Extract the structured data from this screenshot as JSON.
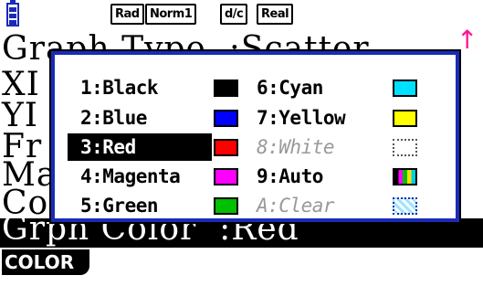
{
  "status_bar": {
    "angle_mode": "Rad",
    "display_mode": "Norm1",
    "fraction_mode": "d/c",
    "complex_mode": "Real"
  },
  "background": {
    "line1": "Graph Type  :Scatter",
    "line2": "XI",
    "line3": "YI",
    "line4": "Fr",
    "line5": "Ma",
    "line6": "Co",
    "line7": "Grph Color  :Red"
  },
  "function_keys": {
    "f1": "COLOR"
  },
  "color_menu": {
    "items": [
      {
        "label": "1:Black",
        "color": "#000000"
      },
      {
        "label": "2:Blue",
        "color": "#0000ff"
      },
      {
        "label": "3:Red",
        "color": "#ff0000"
      },
      {
        "label": "4:Magenta",
        "color": "#ff00ff"
      },
      {
        "label": "5:Green",
        "color": "#00c000"
      },
      {
        "label": "6:Cyan",
        "color": "#00e0ff"
      },
      {
        "label": "7:Yellow",
        "color": "#ffff00"
      },
      {
        "label": "8:White",
        "color": "#ffffff"
      },
      {
        "label": "9:Auto",
        "color": "multicolor"
      },
      {
        "label": "A:Clear",
        "color": "transparent"
      }
    ],
    "selected": "3:Red",
    "disabled": [
      "8:White",
      "A:Clear"
    ]
  }
}
